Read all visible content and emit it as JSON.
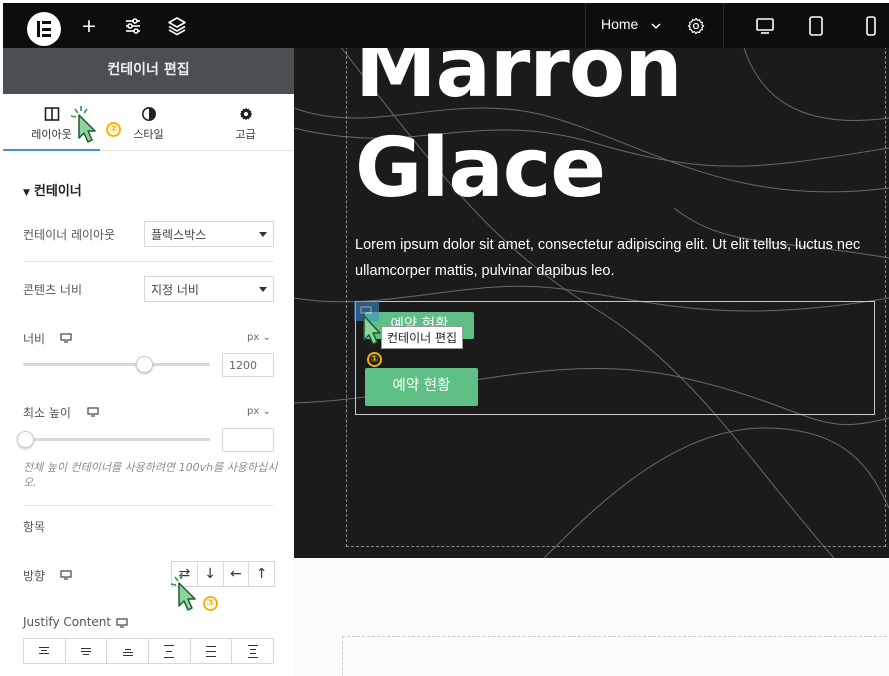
{
  "topbar": {
    "page_label": "Home",
    "icons": [
      "elementor-logo-icon",
      "plus-icon",
      "sliders-icon",
      "layers-icon",
      "chevron-down-icon",
      "gear-icon",
      "desktop-icon",
      "tablet-icon",
      "mobile-icon"
    ],
    "active_device": "desktop"
  },
  "panel": {
    "header": "컨테이너 편집",
    "tabs": [
      {
        "label": "레이아웃",
        "icon": "layout-icon",
        "active": true
      },
      {
        "label": "스타일",
        "icon": "contrast-icon",
        "active": false
      },
      {
        "label": "고급",
        "icon": "gear-icon",
        "active": false
      }
    ],
    "section_title": "컨테이너",
    "fields": {
      "container_layout": {
        "label": "컨테이너 레이아웃",
        "value": "플렉스박스"
      },
      "content_width": {
        "label": "콘텐츠 너비",
        "value": "지정 너비"
      },
      "width": {
        "label": "너비",
        "unit": "px",
        "value": "1200",
        "slider_fraction": 0.64
      },
      "min_height": {
        "label": "최소 높이",
        "unit": "px",
        "value": "",
        "slider_fraction": 0.0
      },
      "min_height_hint": "전체 높이 컨테이너를 사용하려면 100vh를 사용하십시오."
    },
    "items_title": "항목",
    "direction": {
      "label": "방향",
      "buttons": [
        "⇄",
        "↓",
        "←",
        "↑"
      ]
    },
    "justify": {
      "label": "Justify Content"
    },
    "collapse_arrow": "‹"
  },
  "canvas": {
    "heading_line1": "Marron",
    "heading_line2": "Glace",
    "paragraph": "Lorem ipsum dolor sit amet, consectetur adipiscing elit. Ut elit tellus, luctus nec ullamcorper mattis, pulvinar dapibus leo.",
    "button_top": "예약 현황",
    "button_main": "예약 현황",
    "tooltip": "컨테이너 편집"
  },
  "annotations": {
    "step1": "①",
    "step2": "②",
    "step3": "③"
  },
  "colors": {
    "topbar_bg": "#0c0d0e",
    "panel_header_bg": "#4b4e52",
    "canvas_bg": "#1b1b1b",
    "accent_button": "#5ec084",
    "tab_active": "#4b8dd1",
    "badge": "#f3b400"
  }
}
